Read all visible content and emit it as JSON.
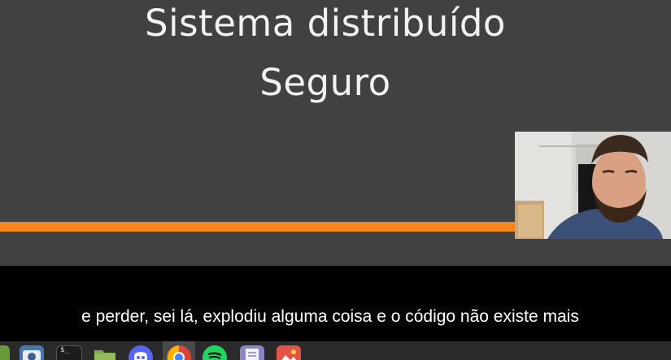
{
  "slide": {
    "title_line1": "Sistema distribuído",
    "title_line2": "Seguro",
    "accent_color": "#f7861c",
    "background_color": "#414141"
  },
  "subtitle": {
    "text": "e perder, sei lá, explodiu alguma coisa e o código não existe mais"
  },
  "taskbar": {
    "apps": [
      {
        "icon": "app-icon"
      },
      {
        "icon": "camera-icon"
      },
      {
        "icon": "terminal-icon",
        "glyph": "$_"
      },
      {
        "icon": "folder-icon"
      },
      {
        "icon": "discord-icon"
      },
      {
        "icon": "chrome-icon"
      },
      {
        "icon": "spotify-icon"
      },
      {
        "icon": "text-editor-icon"
      },
      {
        "icon": "image-viewer-icon"
      }
    ]
  }
}
